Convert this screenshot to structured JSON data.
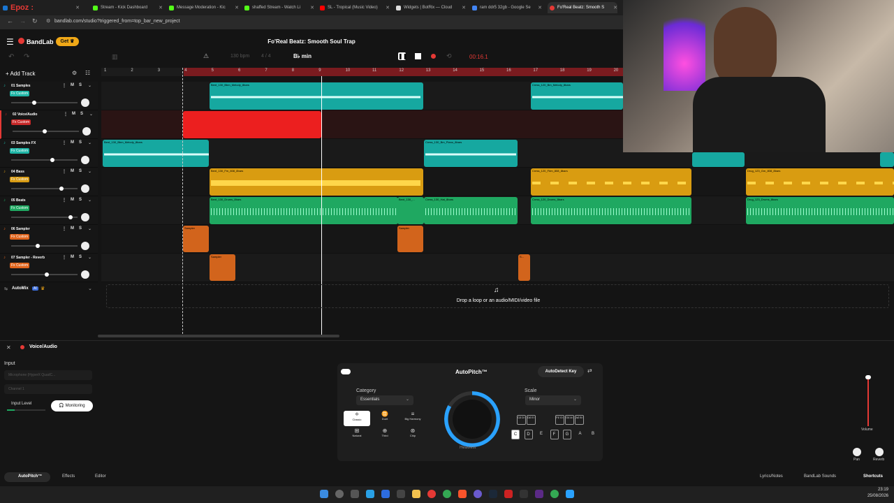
{
  "browser": {
    "tabs": [
      {
        "label": "Epoz :",
        "color": "#e53935"
      },
      {
        "label": "Stream - Kick Dashboard",
        "color": "#53fc18"
      },
      {
        "label": "Message Moderation - Kic",
        "color": "#53fc18"
      },
      {
        "label": "shaffed Stream - Watch Li",
        "color": "#53fc18"
      },
      {
        "label": "SL - Tropical (Music Video)",
        "color": "#ff0000"
      },
      {
        "label": "Widgets | BotRix — Cloud",
        "color": "#ffffff"
      },
      {
        "label": "ram ddr5 32gb - Google Se",
        "color": "#4285f4"
      },
      {
        "label": "Fo'Real Beatz: Smooth S",
        "color": "#e53935"
      }
    ],
    "url": "bandlab.com/studio?triggered_from=top_bar_new_project"
  },
  "header": {
    "logo": "BandLab",
    "get_label": "Get",
    "song_title": "Fo'Real Beatz: Smooth Soul Trap",
    "bpm": "130 bpm",
    "time_sig": "4 / 4",
    "key": "B♭ min",
    "timecode": "00:16.1",
    "add_track": "Add Track"
  },
  "ruler": [
    "1",
    "2",
    "3",
    "4",
    "5",
    "6",
    "7",
    "8",
    "9",
    "10",
    "11",
    "12",
    "13",
    "14",
    "15",
    "16",
    "17",
    "18",
    "19",
    "20"
  ],
  "tracks": [
    {
      "name": "01  Samples",
      "fx": "Fx Custom",
      "fx_color": "#1fb5a6"
    },
    {
      "name": "02  Voice/Audio",
      "fx": "Fx Custom",
      "fx_color": "#c62828"
    },
    {
      "name": "03  Samples FX",
      "fx": "Fx Custom",
      "fx_color": "#1fb5a6"
    },
    {
      "name": "04  Bass",
      "fx": "Fx Custom",
      "fx_color": "#d79b14"
    },
    {
      "name": "05  Beats",
      "fx": "Fx Custom",
      "fx_color": "#1fa861"
    },
    {
      "name": "06  Sampler",
      "fx": "Fx Custom",
      "fx_color": "#e0641c"
    },
    {
      "name": "07  Sampler - Reverb",
      "fx": "Fx Custom",
      "fx_color": "#e0641c"
    }
  ],
  "clips": {
    "samples_1": "Bent_130_Bbm_Melody_8bars",
    "samples_2": "Cress_120_Bm_Melody_8bars",
    "fx_1": "Bent_130_Bbm_Melody_8bars",
    "fx_2": "Cress_130_Bm_Piano_8bars",
    "bass_1": "Bent_130_Fm_808_8bars",
    "bass_2": "Cress_120_F#m_808_8bars",
    "bass_3": "Drug_123_Gm_808_8bars",
    "beats_1": "Bent_130_Drums_8bars",
    "beats_2": "Bent_130_...",
    "beats_3": "Cress_130_Hat_8bars",
    "beats_4": "Cress_120_Drums_8bars",
    "beats_5": "Drug_123_Drums_8bars",
    "sampler": "Sampler",
    "sampler_short": "S..."
  },
  "automix": "AutoMix",
  "automix_badge": "AI",
  "dropzone": "Drop a loop or an audio/MIDI/video file",
  "panel": {
    "track_label": "Voice/Audio",
    "input_label": "Input",
    "input_device": "Microphone (HyperX QuadC...",
    "channel": "Channel 1",
    "input_level": "Input Level",
    "monitoring": "Monitoring",
    "autopitch_title": "AutoPitch™",
    "autodetect": "AutoDetect Key",
    "category_label": "Category",
    "category_value": "Essentials",
    "scale_label": "Scale",
    "scale_value": "Minor",
    "presets": [
      "Classic",
      "Duet",
      "Big Harmony",
      "Natural",
      "Third",
      "Chip"
    ],
    "knob_label": "Heaviest",
    "sharps": [
      "C♯ D♭",
      "D♯ E♭",
      "F♯ G♭",
      "G♯ A♭",
      "A♯ B♭"
    ],
    "keys": [
      "C",
      "D",
      "E",
      "F",
      "G",
      "A",
      "B"
    ],
    "volume": "Volume",
    "pan": "Pan",
    "reverb": "Reverb"
  },
  "bottom_tabs": [
    "AutoPitch™",
    "Effects",
    "Editor"
  ],
  "bottom_right": [
    "Lyrics/Notes",
    "BandLab Sounds",
    "Shortcuts"
  ],
  "clock": {
    "time": "23:19",
    "date": "25/08/2026"
  },
  "accent": "#e53935"
}
